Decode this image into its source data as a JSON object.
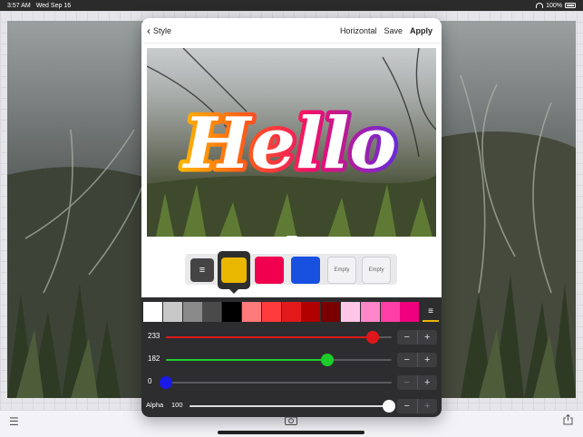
{
  "status": {
    "time": "3:57 AM",
    "date": "Wed Sep 16",
    "battery": "100%"
  },
  "nav": {
    "back_label": "Style",
    "orientation_label": "Horizontal",
    "save_label": "Save",
    "apply_label": "Apply"
  },
  "preview": {
    "text": "Hello"
  },
  "slots": {
    "selected_color": "#e9b600",
    "color2": "#f0004f",
    "color3": "#1850e0",
    "empty1": "Empty",
    "empty2": "Empty"
  },
  "palette": [
    "#ffffff",
    "#c8c8c8",
    "#8a8a8a",
    "#4a4a4a",
    "#000000",
    "#ff7a7a",
    "#ff3b3b",
    "#e21a1a",
    "#b00000",
    "#7a0000",
    "#ffc6e8",
    "#ff86c9",
    "#ff3fa5",
    "#f0007c"
  ],
  "sliders": {
    "red": {
      "value": "233",
      "fraction": 0.914,
      "color": "#e0161b"
    },
    "green": {
      "value": "182",
      "fraction": 0.714,
      "color": "#1ccd29"
    },
    "blue": {
      "value": "0",
      "fraction": 0.0,
      "color": "#1a1ae6"
    }
  },
  "alpha": {
    "label": "Alpha",
    "value": "100",
    "fraction": 1.0
  }
}
